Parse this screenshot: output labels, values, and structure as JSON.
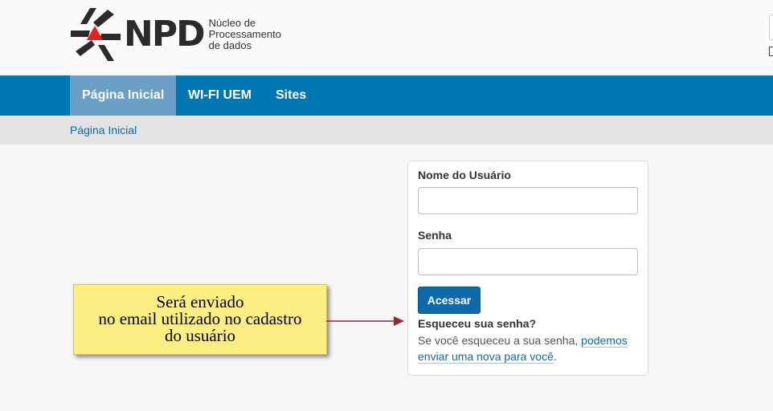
{
  "header": {
    "logo_text": "NPD",
    "logo_subtitle": [
      "Núcleo de",
      "Processamento",
      "de dados"
    ]
  },
  "nav": {
    "items": [
      {
        "label": "Página Inicial",
        "active": true
      },
      {
        "label": "WI-FI UEM",
        "active": false
      },
      {
        "label": "Sites",
        "active": false
      }
    ]
  },
  "breadcrumb": {
    "current": "Página Inicial"
  },
  "login": {
    "username_label": "Nome do Usuário",
    "username_value": "",
    "password_label": "Senha",
    "password_value": "",
    "submit_label": "Acessar",
    "forgot_title": "Esqueceu sua senha?",
    "forgot_text_before": "Se você esqueceu a sua senha, ",
    "forgot_link": "podemos enviar uma nova para você",
    "forgot_text_after": "."
  },
  "annotation": {
    "lines": [
      "Será enviado",
      "no email utilizado no cadastro",
      "do usuário"
    ]
  },
  "colors": {
    "nav_bg": "#0077b3",
    "nav_active_bg": "#6b9fc5",
    "link": "#0e6aa8",
    "note_bg": "#fdee83",
    "arrow": "#8b2e33",
    "logo_red": "#e02424"
  }
}
